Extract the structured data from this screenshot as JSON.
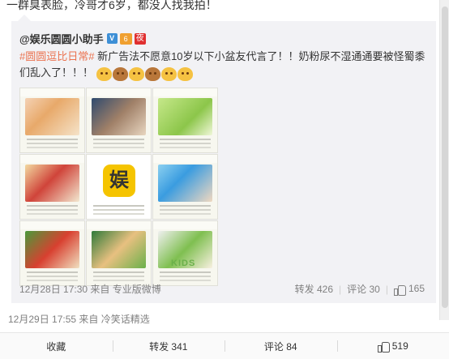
{
  "post": {
    "text": "一群臭表脸，冷哥才6岁，都没人找我拍！"
  },
  "repost": {
    "author": "@娱乐圆圆小助手",
    "badges": {
      "verified": "V",
      "vip": "6",
      "night": "夜"
    },
    "hashtag": "#圆圆逗比日常#",
    "body": " 新广告法不愿意10岁以下小盆友代言了！！奶粉尿不湿通通要被怪蜀黍们乱入了！！！",
    "emoji_count": 6,
    "timestamp": "12月28日 17:30",
    "source": "来自 专业版微博",
    "repost_label": "转发",
    "repost_count": "426",
    "comment_label": "评论",
    "comment_count": "30",
    "like_count": "165",
    "images": [
      {
        "name": "ad-image-1"
      },
      {
        "name": "ad-image-2"
      },
      {
        "name": "ad-image-3"
      },
      {
        "name": "ad-image-4"
      },
      {
        "name": "ad-image-5",
        "logo_text": "娱"
      },
      {
        "name": "ad-image-6"
      },
      {
        "name": "ad-image-7"
      },
      {
        "name": "ad-image-8"
      },
      {
        "name": "ad-image-9",
        "label": "KIDS"
      }
    ]
  },
  "outer_meta": {
    "timestamp": "12月29日 17:55",
    "source": "来自 冷笑话精选"
  },
  "toolbar": {
    "favorite_label": "收藏",
    "repost_label": "转发 341",
    "comment_label": "评论 84",
    "like_count": "519"
  },
  "colors": {
    "hashtag": "#eb7350",
    "repost_bg": "#f2f2f5",
    "meta_text": "#808080"
  }
}
